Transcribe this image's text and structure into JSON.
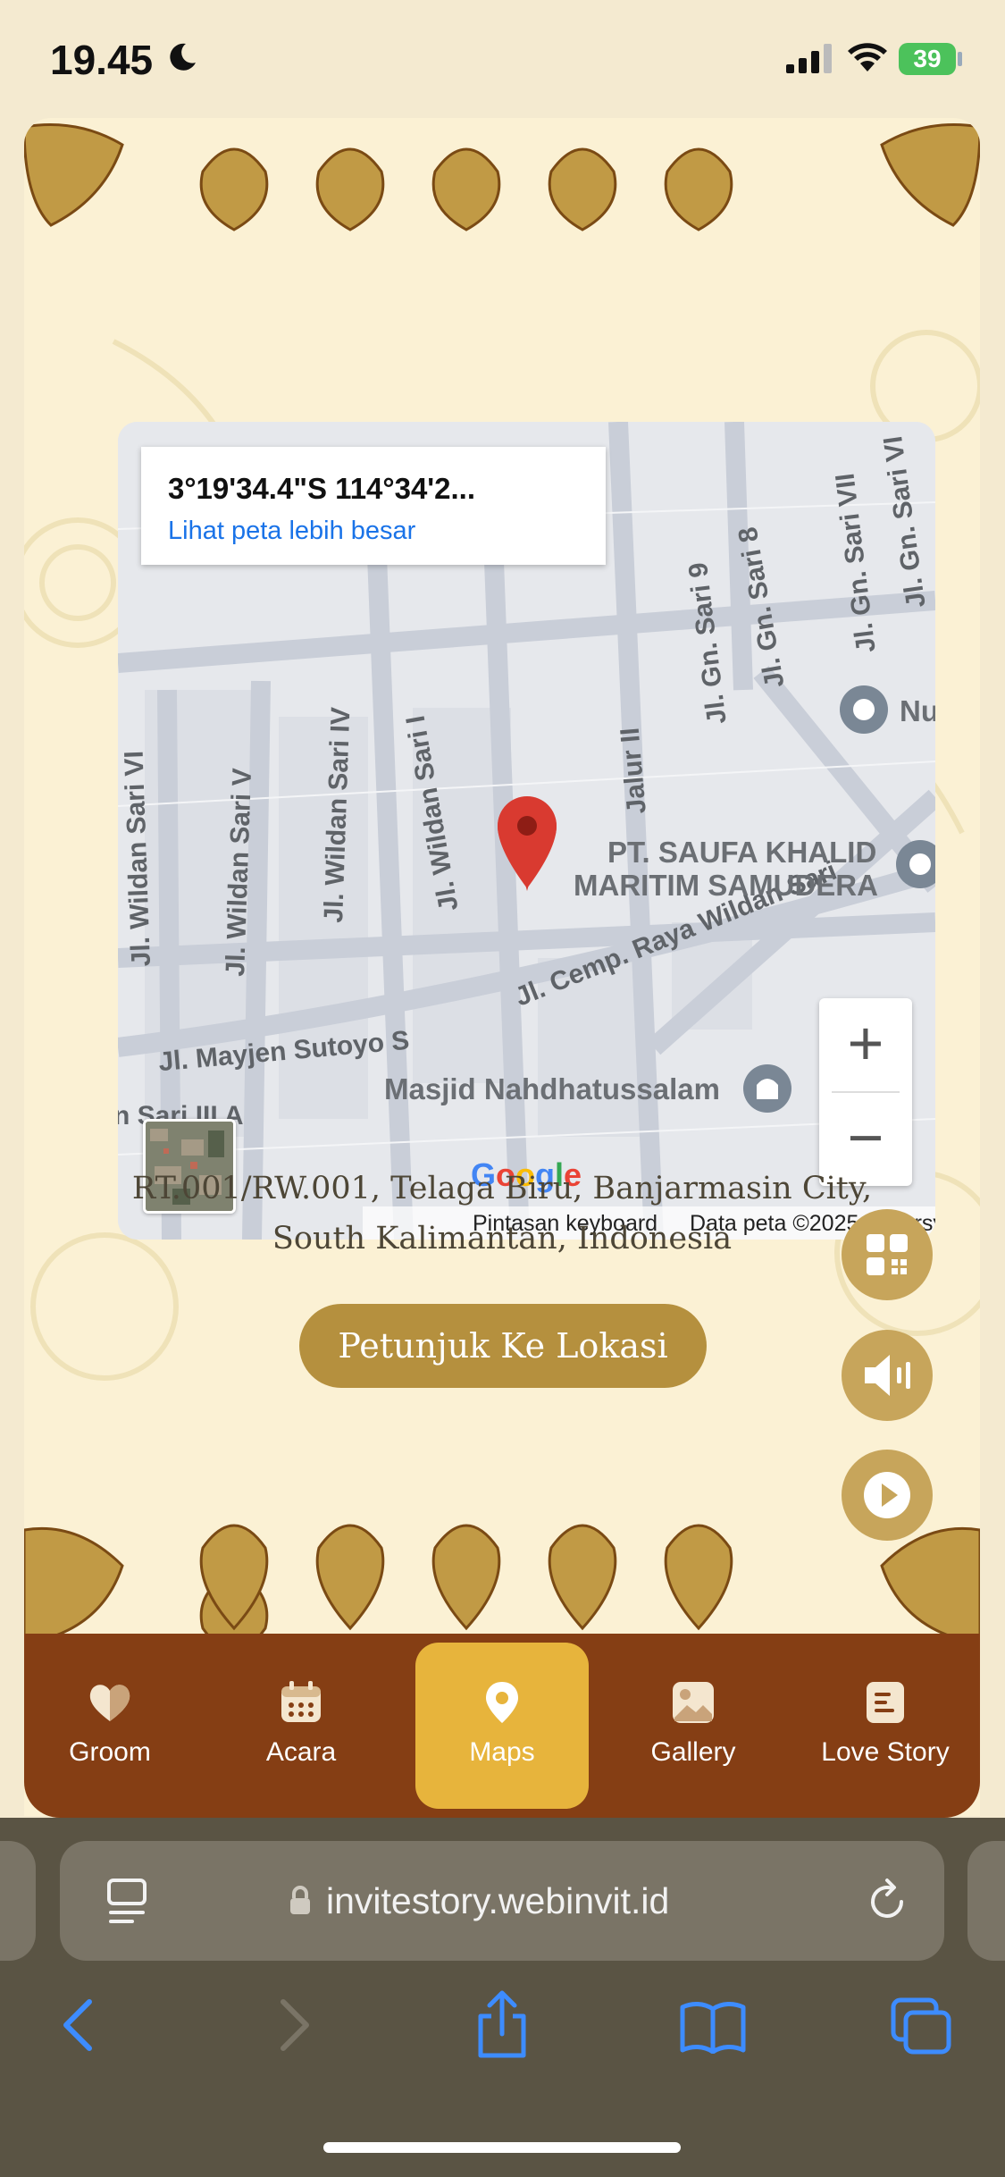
{
  "status_bar": {
    "time": "19.45",
    "battery": "39"
  },
  "map": {
    "coordinates": "3°19'34.4\"S 114°34'2...",
    "view_larger_link": "Lihat peta lebih besar",
    "labels": {
      "street_1": "Jl. Wildan Sari VI",
      "street_2": "Jl. Wildan Sari V",
      "street_3": "Jl. Wildan Sari IV",
      "street_4": "Jl. Wildan Sari I",
      "street_5": "Jalur II",
      "street_6": "Jl. Gn. Sari 9",
      "street_7": "Jl. Gn. Sari 8",
      "street_8": "Jl. Gn. Sari VII",
      "street_9": "Jl. Gn. Sari VI",
      "street_10": "Jl. Mayjen Sutoyo S",
      "street_11": "Jl. Cemp. Raya Wildan Sari",
      "street_12": "n Sari III A",
      "poi_1": "PT. SAUFA KHALID",
      "poi_1b": "MARITIM SAMUDERA",
      "poi_2": "Masjid Nahdhatussalam",
      "poi_3": "Nu"
    },
    "zoom_in": "+",
    "zoom_out": "−",
    "google_logo": "Google",
    "attribution": {
      "shortcuts": "Pintasan keyboard",
      "data": "Data peta ©2025",
      "terms": "Persyaratan"
    }
  },
  "address": {
    "line1": "RT.001/RW.001, Telaga Biru, Banjarmasin City,",
    "line2": "South Kalimantan, Indonesia"
  },
  "directions_button": "Petunjuk Ke Lokasi",
  "nav": {
    "items": [
      {
        "label": "Groom",
        "icon": "heart-icon"
      },
      {
        "label": "Acara",
        "icon": "calendar-icon"
      },
      {
        "label": "Maps",
        "icon": "map-pin-icon"
      },
      {
        "label": "Gallery",
        "icon": "image-icon"
      },
      {
        "label": "Love Story",
        "icon": "document-icon"
      }
    ],
    "active": "Maps"
  },
  "browser": {
    "url": "invitestory.webinvit.id"
  },
  "colors": {
    "accent": "#b5903e",
    "nav_bg": "#853e14",
    "nav_active": "#e7b43c",
    "card_bg": "#fbf1d4"
  }
}
